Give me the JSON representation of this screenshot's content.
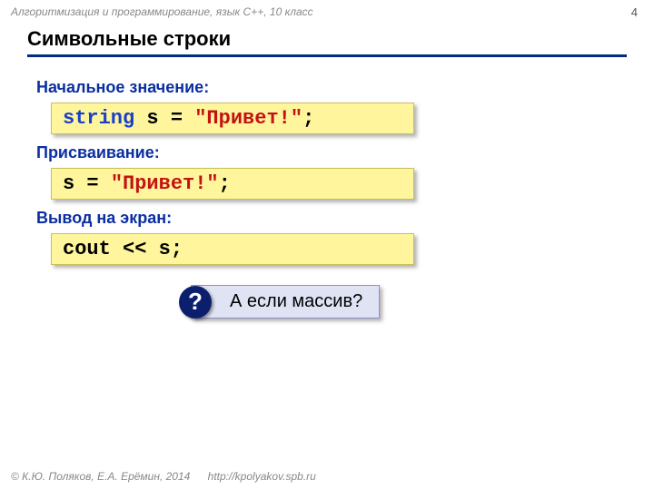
{
  "header": {
    "course_line": "Алгоритмизация и программирование, язык C++, 10 класс",
    "page_number": "4"
  },
  "title": "Символьные строки",
  "sections": [
    {
      "heading": "Начальное значение:",
      "code": {
        "kw1": "string",
        "mid1": " s = ",
        "lit1": "\"Привет!\"",
        "end1": ";"
      }
    },
    {
      "heading": "Присваивание:",
      "code": {
        "plain1": "s = ",
        "lit1": "\"Привет!\"",
        "end1": ";"
      }
    },
    {
      "heading": "Вывод на экран:",
      "code": {
        "plain1": "cout << s;"
      }
    }
  ],
  "question": {
    "badge": "?",
    "text": "А если массив?"
  },
  "footer": {
    "authors": "© К.Ю. Поляков, Е.А. Ерёмин, 2014",
    "url": "http://kpolyakov.spb.ru"
  }
}
